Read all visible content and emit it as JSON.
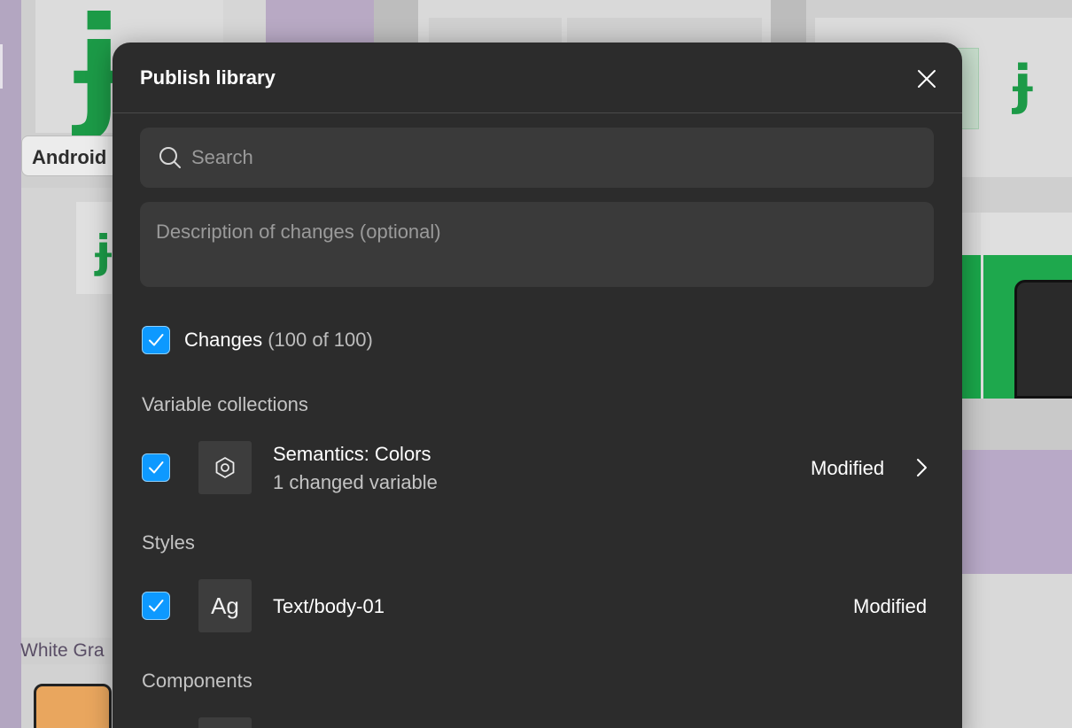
{
  "background": {
    "android_label": "Android",
    "white_label": "White Gra",
    "logo_glyph": "ɉ"
  },
  "dialog": {
    "title": "Publish library",
    "close_icon": "close-icon",
    "search": {
      "placeholder": "Search",
      "value": ""
    },
    "description": {
      "placeholder": "Description of changes (optional)",
      "value": ""
    },
    "changes": {
      "label": "Changes",
      "count": "(100 of 100)",
      "checked": true
    },
    "sections": [
      {
        "heading": "Variable collections",
        "items": [
          {
            "name": "Semantics: Colors",
            "subtitle": "1 changed variable",
            "status": "Modified",
            "icon": "variable-collection-icon",
            "checked": true,
            "has_chevron": true
          }
        ]
      },
      {
        "heading": "Styles",
        "items": [
          {
            "name": "Text/body-01",
            "status": "Modified",
            "icon_text": "Ag",
            "checked": true,
            "has_chevron": false
          }
        ]
      },
      {
        "heading": "Components",
        "items": []
      }
    ]
  },
  "colors": {
    "dialog_bg": "#2c2c2c",
    "input_bg": "#3a3a3a",
    "checkbox_blue": "#0d99ff",
    "brand_green": "#1c9a47"
  }
}
